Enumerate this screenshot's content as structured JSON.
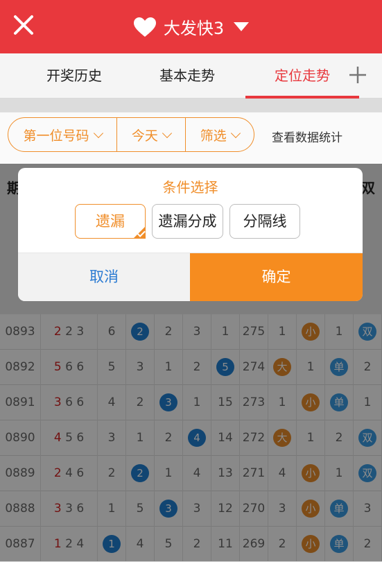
{
  "header": {
    "title": "大发快3"
  },
  "tabs": [
    {
      "label": "开奖历史",
      "active": false
    },
    {
      "label": "基本走势",
      "active": false
    },
    {
      "label": "定位走势",
      "active": true
    }
  ],
  "filters": {
    "position": "第一位号码",
    "date": "今天",
    "filter": "筛选",
    "stats": "查看数据统计"
  },
  "table": {
    "header_left": "期",
    "header_right": "双",
    "rows": [
      {
        "issue": "0893",
        "n1": "2",
        "n2": "2",
        "n3": "3",
        "cells": [
          {
            "t": "6"
          },
          {
            "t": "2",
            "c": "blue"
          },
          {
            "t": "2"
          },
          {
            "t": "3"
          },
          {
            "t": "1"
          },
          {
            "t": "275"
          },
          {
            "t": "1"
          },
          {
            "t": "小",
            "c": "orange"
          },
          {
            "t": "1"
          },
          {
            "t": "双",
            "c": "lblue"
          }
        ]
      },
      {
        "issue": "0892",
        "n1": "5",
        "n2": "6",
        "n3": "6",
        "cells": [
          {
            "t": "5"
          },
          {
            "t": "3"
          },
          {
            "t": "1"
          },
          {
            "t": "2"
          },
          {
            "t": "5",
            "c": "blue"
          },
          {
            "t": "274"
          },
          {
            "t": "大",
            "c": "orange"
          },
          {
            "t": "1"
          },
          {
            "t": "单",
            "c": "lblue"
          },
          {
            "t": "2"
          }
        ]
      },
      {
        "issue": "0891",
        "n1": "3",
        "n2": "6",
        "n3": "6",
        "cells": [
          {
            "t": "4"
          },
          {
            "t": "2"
          },
          {
            "t": "3",
            "c": "blue"
          },
          {
            "t": "1"
          },
          {
            "t": "15"
          },
          {
            "t": "273"
          },
          {
            "t": "1"
          },
          {
            "t": "小",
            "c": "orange"
          },
          {
            "t": "单",
            "c": "lblue"
          },
          {
            "t": "1"
          }
        ]
      },
      {
        "issue": "0890",
        "n1": "4",
        "n2": "5",
        "n3": "6",
        "cells": [
          {
            "t": "3"
          },
          {
            "t": "1"
          },
          {
            "t": "2"
          },
          {
            "t": "4",
            "c": "blue"
          },
          {
            "t": "14"
          },
          {
            "t": "272"
          },
          {
            "t": "大",
            "c": "orange"
          },
          {
            "t": "1"
          },
          {
            "t": "2"
          },
          {
            "t": "双",
            "c": "lblue"
          }
        ]
      },
      {
        "issue": "0889",
        "n1": "2",
        "n2": "4",
        "n3": "6",
        "cells": [
          {
            "t": "2"
          },
          {
            "t": "2",
            "c": "blue"
          },
          {
            "t": "1"
          },
          {
            "t": "4"
          },
          {
            "t": "13"
          },
          {
            "t": "271"
          },
          {
            "t": "4"
          },
          {
            "t": "小",
            "c": "orange"
          },
          {
            "t": "1"
          },
          {
            "t": "双",
            "c": "lblue"
          }
        ]
      },
      {
        "issue": "0888",
        "n1": "3",
        "n2": "3",
        "n3": "6",
        "cells": [
          {
            "t": "1"
          },
          {
            "t": "5"
          },
          {
            "t": "3",
            "c": "blue"
          },
          {
            "t": "3"
          },
          {
            "t": "12"
          },
          {
            "t": "270"
          },
          {
            "t": "3"
          },
          {
            "t": "小",
            "c": "orange"
          },
          {
            "t": "单",
            "c": "lblue"
          },
          {
            "t": "3"
          }
        ]
      },
      {
        "issue": "0887",
        "n1": "1",
        "n2": "2",
        "n3": "4",
        "cells": [
          {
            "t": "1",
            "c": "blue"
          },
          {
            "t": "4"
          },
          {
            "t": "5"
          },
          {
            "t": "2"
          },
          {
            "t": "11"
          },
          {
            "t": "269"
          },
          {
            "t": "2"
          },
          {
            "t": "小",
            "c": "orange"
          },
          {
            "t": "单",
            "c": "lblue"
          },
          {
            "t": "2"
          }
        ]
      }
    ]
  },
  "dialog": {
    "title": "条件选择",
    "options": [
      "遗漏",
      "遗漏分成",
      "分隔线"
    ],
    "cancel": "取消",
    "confirm": "确定"
  },
  "colors": {
    "brand_red": "#e8383d",
    "accent_orange": "#f68c1f",
    "ball_blue": "#1f7fd0"
  }
}
